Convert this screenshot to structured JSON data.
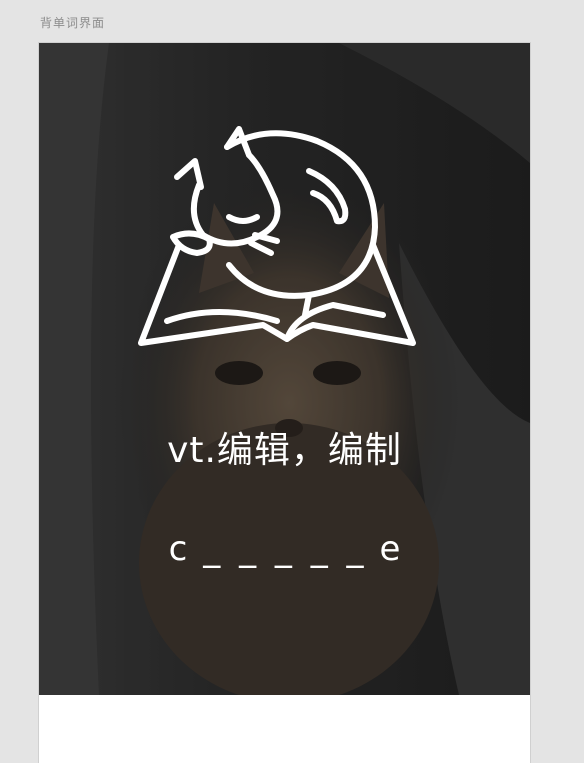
{
  "frame": {
    "title": "背单词界面"
  },
  "card": {
    "background_image": "kitten-photo",
    "logo_icon": "cat-sleeping-on-book-icon",
    "meaning": "vt.编辑，编制",
    "word_puzzle": {
      "first_letter": "c",
      "blanks": "_ _ _ _ _",
      "last_letter": "e"
    }
  },
  "colors": {
    "canvas": "#e4e4e4",
    "photo_dark": "#262626",
    "text": "#ffffff"
  }
}
